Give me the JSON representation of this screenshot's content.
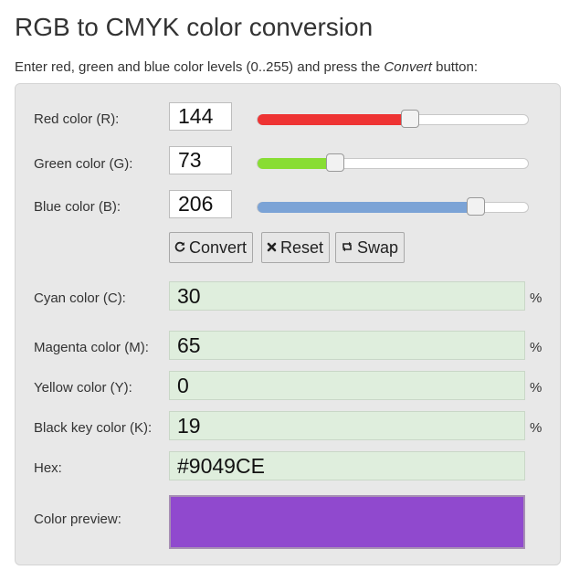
{
  "title": "RGB to CMYK color conversion",
  "intro": {
    "before": "Enter red, green and blue color levels (0..255) and press the ",
    "emph": "Convert",
    "after": " button:"
  },
  "inputs": [
    {
      "label": "Red color (R):",
      "value": "144",
      "level": 0.565,
      "color": "#ee3333"
    },
    {
      "label": "Green color (G):",
      "value": "73",
      "level": 0.286,
      "color": "#88dd33"
    },
    {
      "label": "Blue color (B):",
      "value": "206",
      "level": 0.808,
      "color": "#7ba3d6"
    }
  ],
  "buttons": {
    "convert": "Convert",
    "reset": "Reset",
    "swap": "Swap"
  },
  "outputs": [
    {
      "label": "Cyan color (C):",
      "value": "30",
      "unit": "%"
    },
    {
      "label": "Magenta color (M):",
      "value": "65",
      "unit": "%"
    },
    {
      "label": "Yellow color (Y):",
      "value": "0",
      "unit": "%"
    },
    {
      "label": "Black key color (K):",
      "value": "19",
      "unit": "%"
    }
  ],
  "hex": {
    "label": "Hex:",
    "value": "#9049CE"
  },
  "preview": {
    "label": "Color preview:",
    "color": "#9049CE"
  }
}
